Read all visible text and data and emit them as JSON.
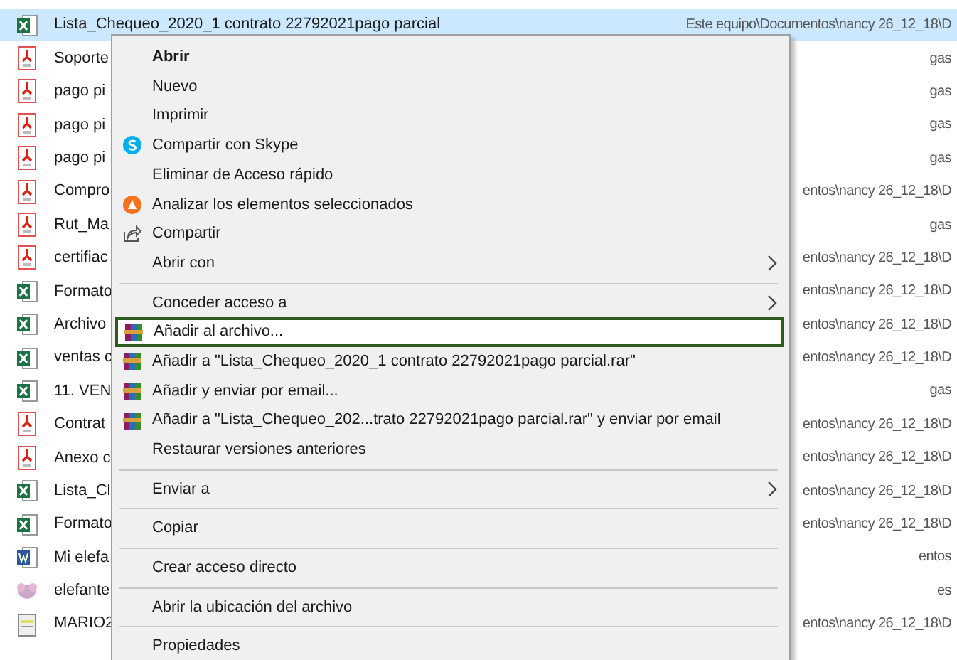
{
  "files": [
    {
      "name": "Lista_Chequeo_2020_1 contrato 22792021pago parcial",
      "location": "Este equipo\\Documentos\\nancy 26_12_18\\D",
      "kind": "excel",
      "selected": true
    },
    {
      "name": "Soporte",
      "location": "gas",
      "kind": "pdf",
      "selected": false
    },
    {
      "name": "pago pi",
      "location": "gas",
      "kind": "pdf",
      "selected": false
    },
    {
      "name": "pago pi",
      "location": "gas",
      "kind": "pdf",
      "selected": false
    },
    {
      "name": "pago pi",
      "location": "gas",
      "kind": "pdf",
      "selected": false
    },
    {
      "name": "Compro",
      "location": "entos\\nancy 26_12_18\\D",
      "kind": "pdf",
      "selected": false
    },
    {
      "name": "Rut_Ma",
      "location": "gas",
      "kind": "pdf",
      "selected": false
    },
    {
      "name": "certifiac",
      "location": "entos\\nancy 26_12_18\\D",
      "kind": "pdf",
      "selected": false
    },
    {
      "name": "Formato",
      "location": "entos\\nancy 26_12_18\\D",
      "kind": "excel",
      "selected": false
    },
    {
      "name": "Archivo",
      "location": "entos\\nancy 26_12_18\\D",
      "kind": "excel",
      "selected": false
    },
    {
      "name": "ventas c",
      "location": "entos\\nancy 26_12_18\\D",
      "kind": "excel",
      "selected": false
    },
    {
      "name": "11. VEN",
      "location": "gas",
      "kind": "excel",
      "selected": false
    },
    {
      "name": "Contrat",
      "location": "entos\\nancy 26_12_18\\D",
      "kind": "pdf",
      "selected": false
    },
    {
      "name": "Anexo c",
      "location": "entos\\nancy 26_12_18\\D",
      "kind": "pdf",
      "selected": false
    },
    {
      "name": "Lista_Cl",
      "location": "entos\\nancy 26_12_18\\D",
      "kind": "excel",
      "selected": false
    },
    {
      "name": "Formato",
      "location": "entos\\nancy 26_12_18\\D",
      "kind": "excel",
      "selected": false
    },
    {
      "name": "Mi elefa",
      "location": "entos",
      "kind": "word",
      "selected": false
    },
    {
      "name": "elefante",
      "location": "es",
      "kind": "image",
      "selected": false
    },
    {
      "name": "MARIO2",
      "location": "entos\\nancy 26_12_18\\D",
      "kind": "document",
      "selected": false
    }
  ],
  "context_menu": [
    {
      "kind": "item",
      "label": "Abrir",
      "default": true,
      "selected": false
    },
    {
      "kind": "item",
      "label": "Nuevo",
      "selected": false
    },
    {
      "kind": "item",
      "label": "Imprimir",
      "selected": false
    },
    {
      "kind": "item",
      "label": "Compartir con Skype",
      "selected": false
    },
    {
      "kind": "item",
      "label": "Eliminar de Acceso rápido",
      "selected": false
    },
    {
      "kind": "item",
      "label": "Analizar los elementos seleccionados",
      "selected": false
    },
    {
      "kind": "item",
      "label": "Compartir",
      "selected": false
    },
    {
      "kind": "item",
      "label": "Abrir con",
      "submenu": true,
      "selected": false
    },
    {
      "kind": "separator"
    },
    {
      "kind": "item",
      "label": "Conceder acceso a",
      "submenu": true,
      "selected": false
    },
    {
      "kind": "item",
      "label": "Añadir al archivo...",
      "selected": true
    },
    {
      "kind": "item",
      "label": "Añadir a \"Lista_Chequeo_2020_1 contrato 22792021pago parcial.rar\"",
      "selected": false
    },
    {
      "kind": "item",
      "label": "Añadir y enviar por email...",
      "selected": false
    },
    {
      "kind": "item",
      "label": "Añadir a \"Lista_Chequeo_202...trato 22792021pago parcial.rar\" y enviar por email",
      "selected": false
    },
    {
      "kind": "item",
      "label": "Restaurar versiones anteriores",
      "selected": false
    },
    {
      "kind": "separator"
    },
    {
      "kind": "item",
      "label": "Enviar a",
      "submenu": true,
      "selected": false
    },
    {
      "kind": "separator"
    },
    {
      "kind": "item",
      "label": "Copiar",
      "selected": false
    },
    {
      "kind": "separator"
    },
    {
      "kind": "item",
      "label": "Crear acceso directo",
      "selected": false
    },
    {
      "kind": "separator"
    },
    {
      "kind": "item",
      "label": "Abrir la ubicación del archivo",
      "selected": false
    },
    {
      "kind": "separator"
    },
    {
      "kind": "item",
      "label": "Propiedades",
      "selected": false
    }
  ]
}
